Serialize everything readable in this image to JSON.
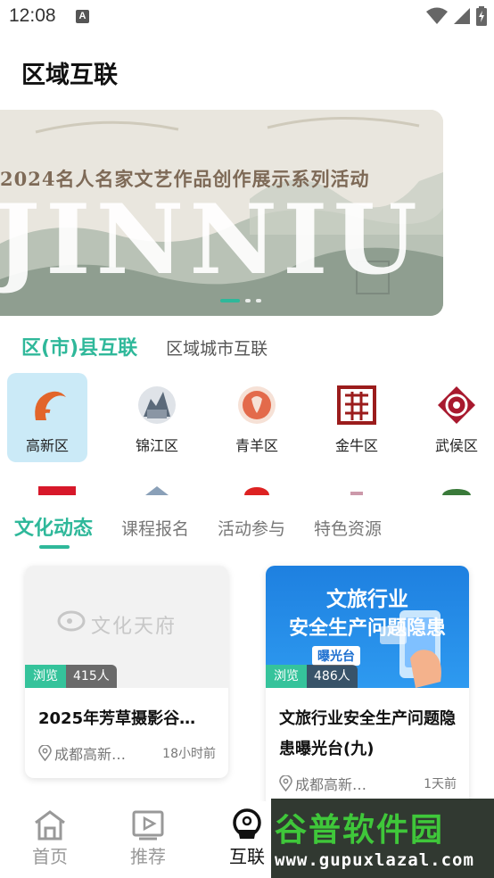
{
  "status_bar": {
    "time": "12:08",
    "notification": "A"
  },
  "header": {
    "title": "区域互联"
  },
  "banner": {
    "title": "2024名人名家文艺作品创作展示系列活动",
    "big_text": "JINNIU"
  },
  "region_tabs": {
    "active": "区(市)县互联",
    "other": "区域城市互联"
  },
  "districts": [
    {
      "label": "高新区",
      "icon": "gaoxin-logo-icon"
    },
    {
      "label": "锦江区",
      "icon": "jinjiang-logo-icon"
    },
    {
      "label": "青羊区",
      "icon": "qingyang-logo-icon"
    },
    {
      "label": "金牛区",
      "icon": "jinniu-logo-icon"
    },
    {
      "label": "武侯区",
      "icon": "wuhou-logo-icon"
    }
  ],
  "culture_tabs": [
    "文化动态",
    "课程报名",
    "活动参与",
    "特色资源"
  ],
  "cards": [
    {
      "cover_text": "文化天府",
      "views_label": "浏览",
      "views_count": "415人",
      "title": "2025年芳草摄影谷…",
      "location": "成都高新…",
      "time": "18小时前"
    },
    {
      "cover_line1": "文旅行业",
      "cover_line2": "安全生产问题隐患",
      "cover_badge": "曝光台",
      "views_label": "浏览",
      "views_count": "486人",
      "title": "文旅行业安全生产问题隐患曝光台(九)",
      "location": "成都高新…",
      "time": "1天前"
    }
  ],
  "bottom_nav": [
    {
      "label": "首页",
      "icon": "home-icon"
    },
    {
      "label": "推荐",
      "icon": "play-icon"
    },
    {
      "label": "互联",
      "icon": "connect-icon",
      "active": true
    }
  ],
  "watermark": {
    "main": "谷普软件园",
    "url": "www.gupuxlazal.com"
  },
  "colors": {
    "accent": "#2fb89a",
    "active_district_bg": "#cbeaf7"
  }
}
